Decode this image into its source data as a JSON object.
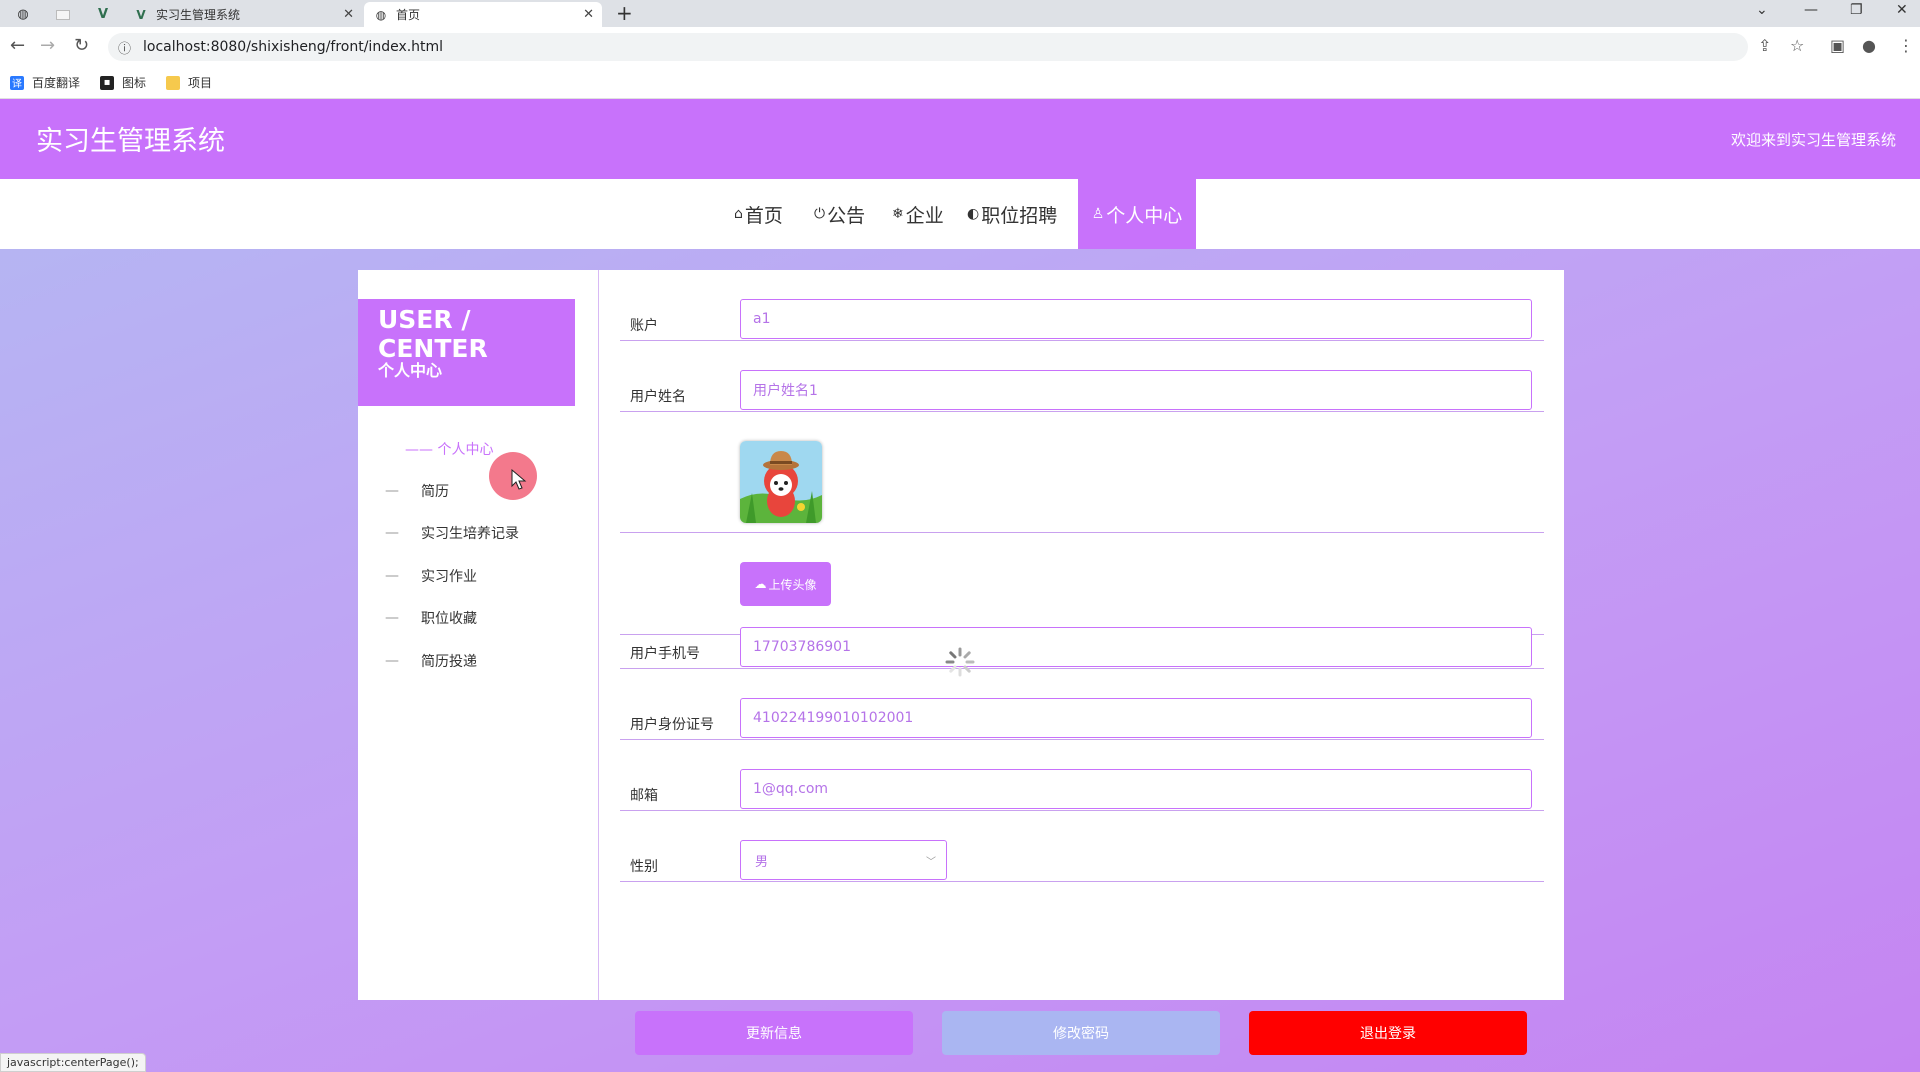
{
  "browser": {
    "tabs": [
      {
        "title": "",
        "pinned": true
      },
      {
        "title": "",
        "pinned": true
      },
      {
        "title": "",
        "pinned": true
      },
      {
        "title": "实习生管理系统",
        "pinned": false
      },
      {
        "title": "首页",
        "pinned": false,
        "active": true
      }
    ],
    "new_tab_glyph": "+",
    "url": "localhost:8080/shixisheng/front/index.html",
    "bookmarks": [
      {
        "label": "百度翻译",
        "icon": "translate-icon"
      },
      {
        "label": "图标",
        "icon": "picture-icon"
      },
      {
        "label": "项目",
        "icon": "folder-icon"
      }
    ],
    "status_text": "javascript:centerPage();"
  },
  "header": {
    "site_title": "实习生管理系统",
    "welcome": "欢迎来到实习生管理系统"
  },
  "nav": {
    "items": [
      {
        "label": "首页",
        "icon": "home-icon"
      },
      {
        "label": "公告",
        "icon": "power-icon"
      },
      {
        "label": "企业",
        "icon": "snowflake-icon"
      },
      {
        "label": "职位招聘",
        "icon": "palette-icon"
      },
      {
        "label": "个人中心",
        "icon": "user-icon",
        "active": true
      }
    ]
  },
  "sidebar": {
    "title": "USER / CENTER",
    "subtitle": "个人中心",
    "active_item": "—— 个人中心",
    "items": [
      "简历",
      "实习生培养记录",
      "实习作业",
      "职位收藏",
      "简历投递"
    ],
    "dash": "—"
  },
  "form": {
    "account": {
      "label": "账户",
      "value": "a1"
    },
    "name": {
      "label": "用户姓名",
      "value": "用户姓名1"
    },
    "upload_label": "上传头像",
    "phone": {
      "label": "用户手机号",
      "value": "17703786901"
    },
    "id_card": {
      "label": "用户身份证号",
      "value": "410224199010102001"
    },
    "email": {
      "label": "邮箱",
      "value": "1@qq.com"
    },
    "gender": {
      "label": "性别",
      "value": "男"
    }
  },
  "buttons": {
    "update": "更新信息",
    "change_password": "修改密码",
    "logout": "退出登录"
  },
  "colors": {
    "accent": "#c872fb",
    "disabled_button": "#aab6f2",
    "danger": "#ff0000"
  }
}
